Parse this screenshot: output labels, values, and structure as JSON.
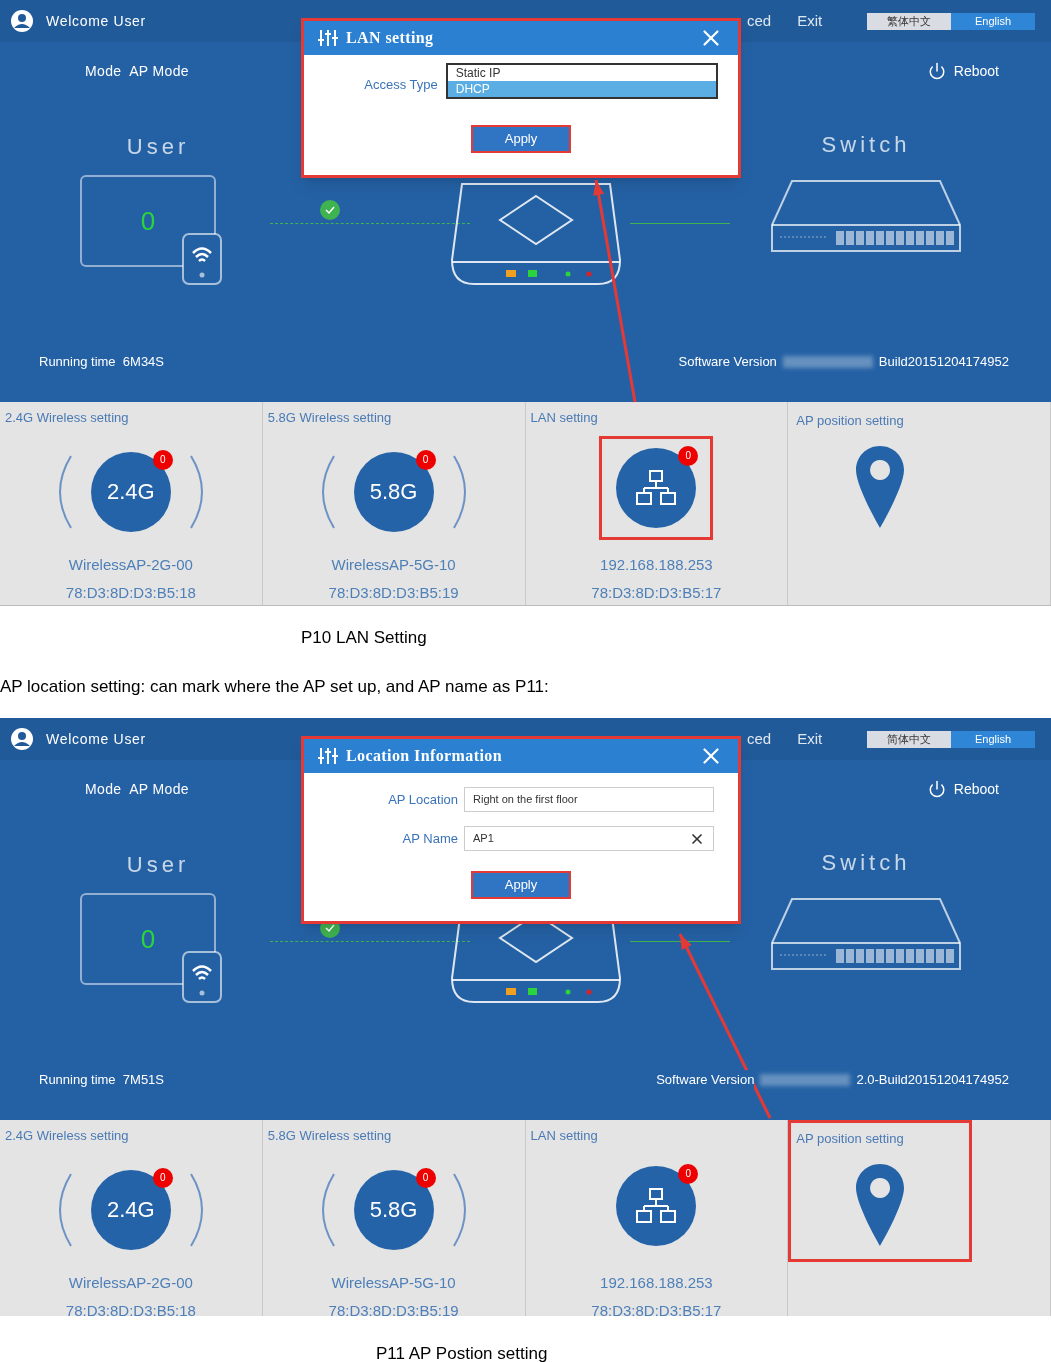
{
  "blocks": [
    {
      "kind": "screen",
      "header": {
        "welcome": "Welcome User",
        "nav": [
          "ced",
          "Exit"
        ],
        "languages": [
          {
            "label": "繁体中文",
            "selected": false
          },
          {
            "label": "English",
            "selected": true
          }
        ]
      },
      "mode": "Mode  AP Mode",
      "reboot": "Reboot",
      "user_label": "User",
      "user_count": "0",
      "switch_label": "Switch",
      "running_time": "Running time  6M34S",
      "software_version": {
        "label": "Software Version",
        "value": "Build20151204174952"
      },
      "dialog": {
        "kind": "lan",
        "title": "LAN setting",
        "field_label": "Access Type",
        "options": [
          {
            "label": "Static IP",
            "selected": false
          },
          {
            "label": "DHCP",
            "selected": true
          }
        ],
        "apply": "Apply"
      },
      "tiles": [
        {
          "kind": "band",
          "title": "2.4G Wireless setting",
          "icon_text": "2.4G",
          "badge": "0",
          "line1": "WirelessAP-2G-00",
          "line2": "78:D3:8D:D3:B5:18"
        },
        {
          "kind": "band",
          "title": "5.8G Wireless setting",
          "icon_text": "5.8G",
          "badge": "0",
          "line1": "WirelessAP-5G-10",
          "line2": "78:D3:8D:D3:B5:19"
        },
        {
          "kind": "lan",
          "title": "LAN setting",
          "badge": "0",
          "line1": "192.168.188.253",
          "line2": "78:D3:8D:D3:B5:17",
          "highlighted": true
        },
        {
          "kind": "location",
          "title": "AP position setting",
          "highlighted": false
        }
      ]
    },
    {
      "kind": "caption",
      "text": "P10 LAN Setting"
    },
    {
      "kind": "paragraph",
      "text": "AP location setting: can mark where the AP set up, and AP name as P11:"
    },
    {
      "kind": "screen",
      "header": {
        "welcome": "Welcome User",
        "nav": [
          "ced",
          "Exit"
        ],
        "languages": [
          {
            "label": "简体中文",
            "selected": false
          },
          {
            "label": "English",
            "selected": true
          }
        ]
      },
      "mode": "Mode  AP Mode",
      "reboot": "Reboot",
      "user_label": "User",
      "user_count": "0",
      "switch_label": "Switch",
      "running_time": "Running time  7M51S",
      "software_version": {
        "label": "Software Version",
        "value": "2.0-Build20151204174952"
      },
      "dialog": {
        "kind": "location",
        "title": "Location Information",
        "fields": [
          {
            "label": "AP Location",
            "value": "Right on the first floor",
            "clearable": false
          },
          {
            "label": "AP Name",
            "value": "AP1",
            "clearable": true
          }
        ],
        "apply": "Apply"
      },
      "tiles": [
        {
          "kind": "band",
          "title": "2.4G Wireless setting",
          "icon_text": "2.4G",
          "badge": "0",
          "line1": "WirelessAP-2G-00",
          "line2": "78:D3:8D:D3:B5:18"
        },
        {
          "kind": "band",
          "title": "5.8G Wireless setting",
          "icon_text": "5.8G",
          "badge": "0",
          "line1": "WirelessAP-5G-10",
          "line2": "78:D3:8D:D3:B5:19"
        },
        {
          "kind": "lan",
          "title": "LAN setting",
          "badge": "0",
          "line1": "192.168.188.253",
          "line2": "78:D3:8D:D3:B5:17",
          "highlighted": false
        },
        {
          "kind": "location",
          "title": "AP position setting",
          "highlighted": true
        }
      ]
    },
    {
      "kind": "caption",
      "text": "P11 AP Postion setting"
    }
  ]
}
